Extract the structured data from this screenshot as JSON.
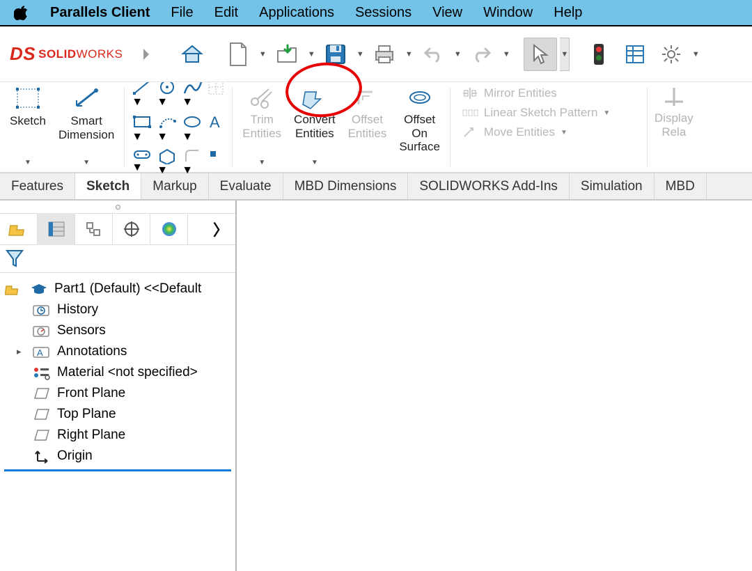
{
  "mac_menu": {
    "app": "Parallels Client",
    "items": [
      "File",
      "Edit",
      "Applications",
      "Sessions",
      "View",
      "Window",
      "Help"
    ]
  },
  "logo": {
    "brand": "SOLID",
    "brand2": "WORKS"
  },
  "ribbon": {
    "sketch": "Sketch",
    "smart_dimension": "Smart\nDimension",
    "trim": "Trim\nEntities",
    "convert": "Convert\nEntities",
    "offset": "Offset\nEntities",
    "offset_surface": "Offset\nOn\nSurface",
    "mirror": "Mirror Entities",
    "linear": "Linear Sketch Pattern",
    "move": "Move Entities",
    "display": "Display\nRela"
  },
  "tabs": [
    "Features",
    "Sketch",
    "Markup",
    "Evaluate",
    "MBD Dimensions",
    "SOLIDWORKS Add-Ins",
    "Simulation",
    "MBD"
  ],
  "active_tab": "Sketch",
  "tree": {
    "root": "Part1 (Default) <<Default",
    "items": [
      {
        "icon": "history",
        "label": "History"
      },
      {
        "icon": "sensors",
        "label": "Sensors"
      },
      {
        "icon": "annotations",
        "label": "Annotations",
        "expandable": true
      },
      {
        "icon": "material",
        "label": "Material <not specified>"
      },
      {
        "icon": "plane",
        "label": "Front Plane"
      },
      {
        "icon": "plane",
        "label": "Top Plane"
      },
      {
        "icon": "plane",
        "label": "Right Plane"
      },
      {
        "icon": "origin",
        "label": "Origin"
      }
    ]
  }
}
